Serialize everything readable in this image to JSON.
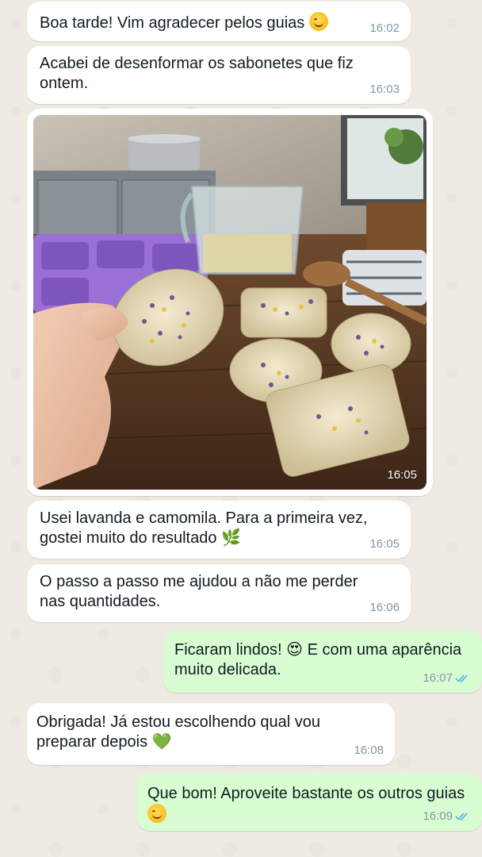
{
  "messages": [
    {
      "text": "Boa tarde! Vim agradecer pelos guias",
      "emoji": "smiling-face",
      "time": "16:02"
    },
    {
      "text": "Acabei de desenformar os sabonetes que fiz ontem.",
      "time": "16:03"
    },
    {
      "photo": "handmade-soaps-lavender-chamomile",
      "time": "16:05"
    },
    {
      "text": "Usei lavanda e camomila. Para a primeira vez, gostei muito do resultado",
      "emoji": "herb",
      "time": "16:05"
    },
    {
      "text": "O passo a passo me ajudou a não me perder nas quantidades.",
      "time": "16:06"
    },
    {
      "text": "Ficaram lindos!",
      "emoji": "heart-eyes",
      "text2": "E com uma aparência muito delicada.",
      "time": "16:07",
      "status": "read"
    },
    {
      "text": "Obrigada! Já estou escolhendo qual vou preparar depois",
      "emoji": "green-heart",
      "time": "16:08"
    },
    {
      "text": "Que bom! Aproveite bastante os outros guias",
      "emoji": "smiling-face",
      "time": "16:09",
      "status": "read"
    }
  ],
  "colors": {
    "wallpaper": "#efeae2",
    "incoming": "#ffffff",
    "outgoing": "#d9fdd3",
    "read_ticks": "#53bdeb",
    "timestamp": "#8696a0"
  }
}
